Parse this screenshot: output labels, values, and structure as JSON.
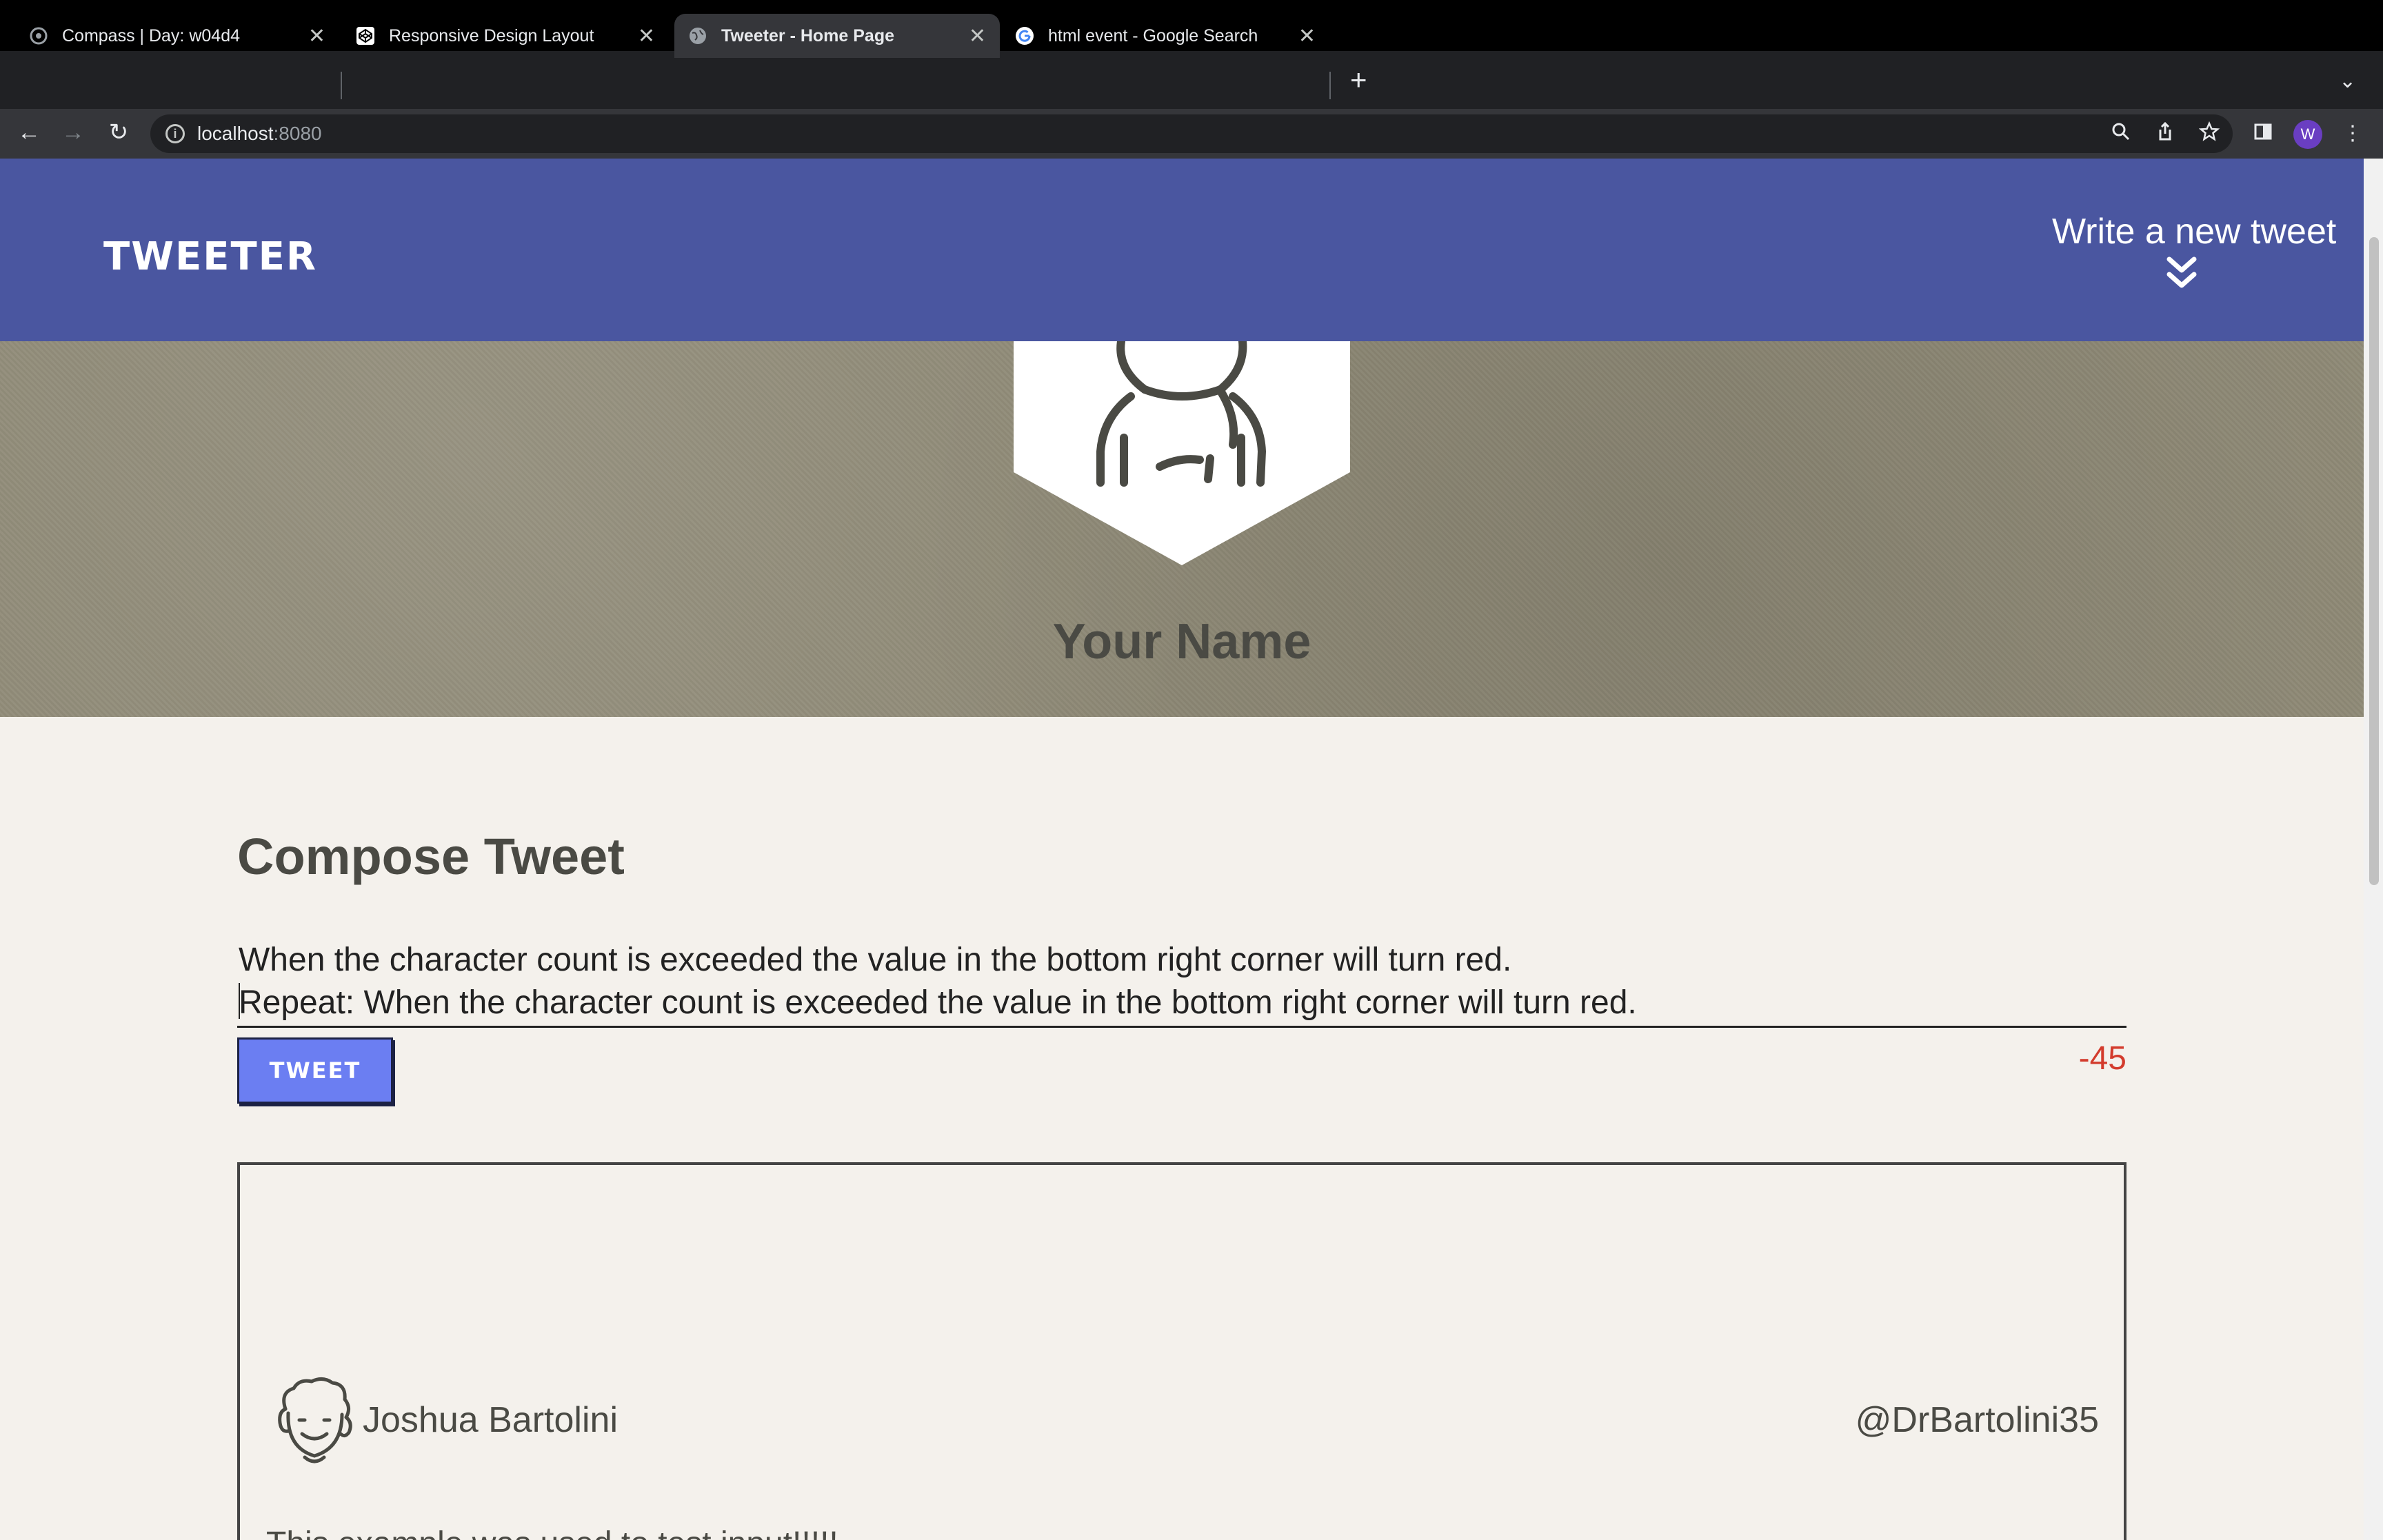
{
  "browser": {
    "tabs": [
      {
        "title": "Compass | Day: w04d4",
        "icon": "compass-icon"
      },
      {
        "title": "Responsive Design Layout",
        "icon": "codepen-icon"
      },
      {
        "title": "Tweeter - Home Page",
        "icon": "globe-icon"
      },
      {
        "title": "html event - Google Search",
        "icon": "google-icon"
      }
    ],
    "active_tab_index": 2,
    "url_host": "localhost",
    "url_port": ":8080",
    "profile_initial": "W"
  },
  "header": {
    "logo": "TWEETER",
    "write_new": "Write a new tweet"
  },
  "profile": {
    "name": "Your Name"
  },
  "compose": {
    "title": "Compose Tweet",
    "line1": "When the character count is exceeded the value in the bottom right corner will turn red.",
    "line2": "Repeat: When the character count is exceeded the value in the bottom right corner will turn red.",
    "button_label": "TWEET",
    "counter": "-45",
    "counter_color": "#d33b2c"
  },
  "tweet": {
    "name": "Joshua Bartolini",
    "handle": "@DrBartolini35",
    "body": "This example was used to test input!!!!!"
  },
  "colors": {
    "header_bg": "#4a56a0",
    "button_bg": "#6b7ef2",
    "page_bg": "#f4f1ec"
  }
}
